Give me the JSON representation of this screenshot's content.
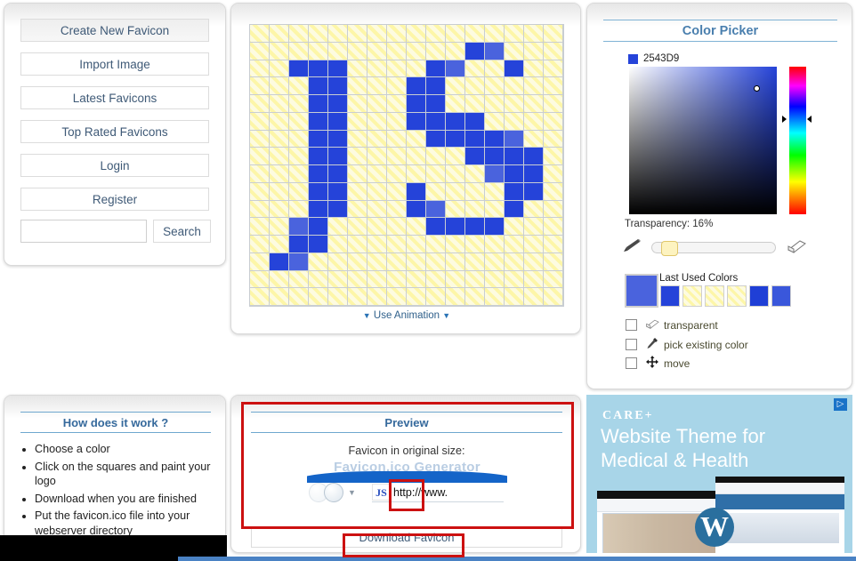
{
  "sidebar": {
    "buttons": [
      {
        "label": "Create New Favicon"
      },
      {
        "label": "Import Image"
      },
      {
        "label": "Latest Favicons"
      },
      {
        "label": "Top Rated Favicons"
      },
      {
        "label": "Login"
      },
      {
        "label": "Register"
      }
    ],
    "search": {
      "value": "",
      "placeholder": "",
      "button_label": "Search"
    }
  },
  "editor": {
    "animation_label": "Use Animation",
    "grid": {
      "columns": 16,
      "rows": 16,
      "fill_color": "#2543D9",
      "light_color": "#4A63DD",
      "empty_style": "transparent-hatch",
      "cells": [
        [
          0,
          0,
          0,
          0,
          0,
          0,
          0,
          0,
          0,
          0,
          0,
          0,
          0,
          0,
          0,
          0
        ],
        [
          0,
          0,
          0,
          0,
          0,
          0,
          0,
          0,
          0,
          0,
          0,
          1,
          2,
          0,
          0,
          0
        ],
        [
          0,
          0,
          1,
          1,
          1,
          0,
          0,
          0,
          0,
          1,
          2,
          0,
          0,
          1,
          0,
          0
        ],
        [
          0,
          0,
          0,
          1,
          1,
          0,
          0,
          0,
          1,
          1,
          0,
          0,
          0,
          0,
          0,
          0
        ],
        [
          0,
          0,
          0,
          1,
          1,
          0,
          0,
          0,
          1,
          1,
          0,
          0,
          0,
          0,
          0,
          0
        ],
        [
          0,
          0,
          0,
          1,
          1,
          0,
          0,
          0,
          1,
          1,
          1,
          1,
          0,
          0,
          0,
          0
        ],
        [
          0,
          0,
          0,
          1,
          1,
          0,
          0,
          0,
          0,
          1,
          1,
          1,
          1,
          2,
          0,
          0
        ],
        [
          0,
          0,
          0,
          1,
          1,
          0,
          0,
          0,
          0,
          0,
          0,
          1,
          1,
          1,
          1,
          0
        ],
        [
          0,
          0,
          0,
          1,
          1,
          0,
          0,
          0,
          0,
          0,
          0,
          0,
          2,
          1,
          1,
          0
        ],
        [
          0,
          0,
          0,
          1,
          1,
          0,
          0,
          0,
          1,
          0,
          0,
          0,
          0,
          1,
          1,
          0
        ],
        [
          0,
          0,
          0,
          1,
          1,
          0,
          0,
          0,
          1,
          2,
          0,
          0,
          0,
          1,
          0,
          0
        ],
        [
          0,
          0,
          2,
          1,
          0,
          0,
          0,
          0,
          0,
          1,
          1,
          1,
          1,
          0,
          0,
          0
        ],
        [
          0,
          0,
          1,
          1,
          0,
          0,
          0,
          0,
          0,
          0,
          0,
          0,
          0,
          0,
          0,
          0
        ],
        [
          0,
          1,
          2,
          0,
          0,
          0,
          0,
          0,
          0,
          0,
          0,
          0,
          0,
          0,
          0,
          0
        ],
        [
          0,
          0,
          0,
          0,
          0,
          0,
          0,
          0,
          0,
          0,
          0,
          0,
          0,
          0,
          0,
          0
        ],
        [
          0,
          0,
          0,
          0,
          0,
          0,
          0,
          0,
          0,
          0,
          0,
          0,
          0,
          0,
          0,
          0
        ]
      ]
    }
  },
  "color_picker": {
    "title": "Color Picker",
    "hex": "2543D9",
    "hex_color": "#2543D9",
    "transparency_label": "Transparency: 16%",
    "transparency_percent": 16,
    "last_used_label": "Last Used Colors",
    "current_swatch": "#4A63DD",
    "swatches": [
      "#2543D9",
      "hatch",
      "hatch",
      "hatch",
      "#1F3FD6",
      "#3A57DB"
    ],
    "options": [
      {
        "label": "transparent",
        "icon": "eraser-icon",
        "checked": false
      },
      {
        "label": "pick existing color",
        "icon": "eyedropper-icon",
        "checked": false
      },
      {
        "label": "move",
        "icon": "move-arrows-icon",
        "checked": false
      }
    ],
    "pencil_icon": "pencil-icon",
    "eraser_icon": "eraser-icon"
  },
  "howto": {
    "title": "How does it work ?",
    "items": [
      "Choose a color",
      "Click on the squares and paint your logo",
      "Download when you are finished",
      "Put the favicon.ico file into your webserver directory"
    ]
  },
  "preview": {
    "title": "Preview",
    "subtitle": "Favicon in original size:",
    "browser_banner_text": "Favicon.ico Generator",
    "favicon_badge": "JS",
    "url_text": "http://www.",
    "download_label": "Download Favicon"
  },
  "advert": {
    "brand": "CARE",
    "brand_plus": "+",
    "headline_line1": "Website Theme for",
    "headline_line2": "Medical & Health",
    "wordpress_mark": "W",
    "adchoices_icon": "adchoices-icon"
  }
}
